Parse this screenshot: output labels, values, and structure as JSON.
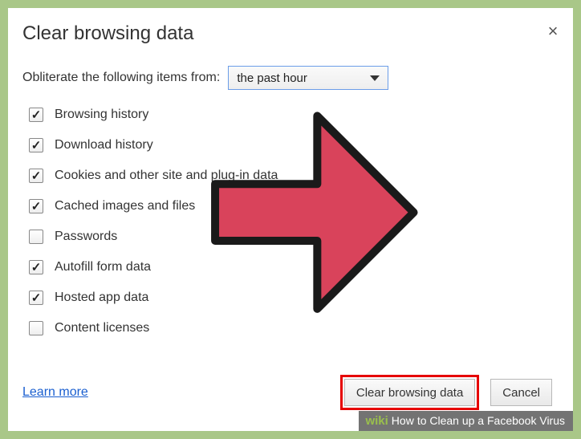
{
  "dialog": {
    "title": "Clear browsing data",
    "time_label": "Obliterate the following items from:",
    "time_selected": "the past hour",
    "items": [
      {
        "label": "Browsing history",
        "checked": true
      },
      {
        "label": "Download history",
        "checked": true
      },
      {
        "label": "Cookies and other site and plug-in data",
        "checked": true
      },
      {
        "label": "Cached images and files",
        "checked": true
      },
      {
        "label": "Passwords",
        "checked": false
      },
      {
        "label": "Autofill form data",
        "checked": true
      },
      {
        "label": "Hosted app data",
        "checked": true
      },
      {
        "label": "Content licenses",
        "checked": false
      }
    ],
    "learn_more": "Learn more",
    "primary_button": "Clear browsing data",
    "cancel_button": "Cancel"
  },
  "caption": {
    "brand_prefix": "wiki",
    "brand_suffix": "How",
    "article": " to Clean up a Facebook Virus"
  }
}
